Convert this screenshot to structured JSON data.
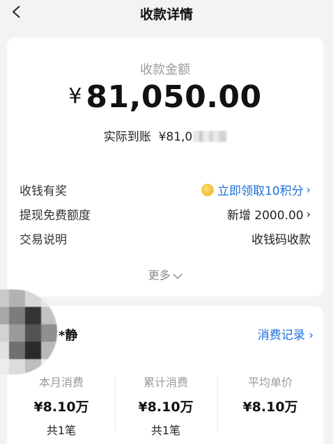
{
  "header": {
    "title": "收款详情"
  },
  "summary": {
    "amount_label": "收款金额",
    "currency": "¥",
    "amount": "81,050.00",
    "received_label": "实际到账",
    "received_value": "¥81,0"
  },
  "details": [
    {
      "label": "收钱有奖",
      "value": "立即领取10积分",
      "icon": "coin-icon",
      "has_chevron": true
    },
    {
      "label": "提现免费额度",
      "value": "新增 2000.00",
      "has_chevron": true
    },
    {
      "label": "交易说明",
      "value": "收钱码收款",
      "has_chevron": false
    }
  ],
  "more_label": "更多",
  "payer": {
    "name": "*静",
    "records_link": "消费记录"
  },
  "stats": [
    {
      "label": "本月消费",
      "value": "¥8.10万",
      "count": "共1笔"
    },
    {
      "label": "累计消费",
      "value": "¥8.10万",
      "count": "共1笔"
    },
    {
      "label": "平均单价",
      "value": "¥8.10万",
      "count": ""
    }
  ],
  "colors": {
    "link": "#1a6fd9",
    "background": "#f3f3f5"
  }
}
